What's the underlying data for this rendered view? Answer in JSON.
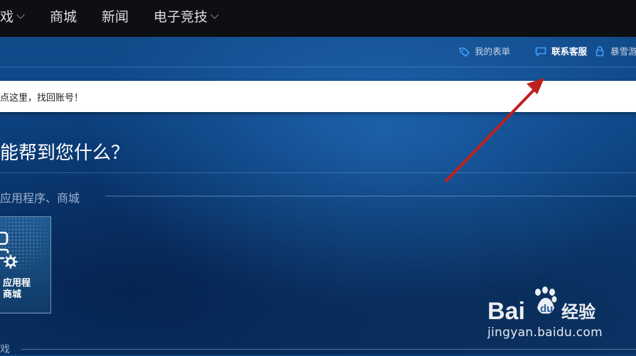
{
  "top_nav": {
    "items": [
      {
        "label": "戏",
        "dropdown": true
      },
      {
        "label": "商城",
        "dropdown": false
      },
      {
        "label": "新闻",
        "dropdown": false
      },
      {
        "label": "电子竞技",
        "dropdown": true
      }
    ]
  },
  "sub_bar": {
    "my_tickets": "我的表单",
    "contact_support": "联系客服",
    "account_cut": "暴雪游"
  },
  "notice": {
    "text": "点这里，找回账号！"
  },
  "hero": {
    "title": "能帮到您什么？"
  },
  "section1": {
    "title": "应用程序、商城",
    "tile_label": "应用程\n商城"
  },
  "section2": {
    "title": "戏"
  },
  "watermark": {
    "brand": "Bai du 经验",
    "url": "jingyan.baidu.com"
  },
  "colors": {
    "nav_bg": "#0e0f12",
    "page_bg": "#0c4486",
    "annotation_arrow": "#c0201c",
    "link_icon": "#3ea0ff"
  }
}
